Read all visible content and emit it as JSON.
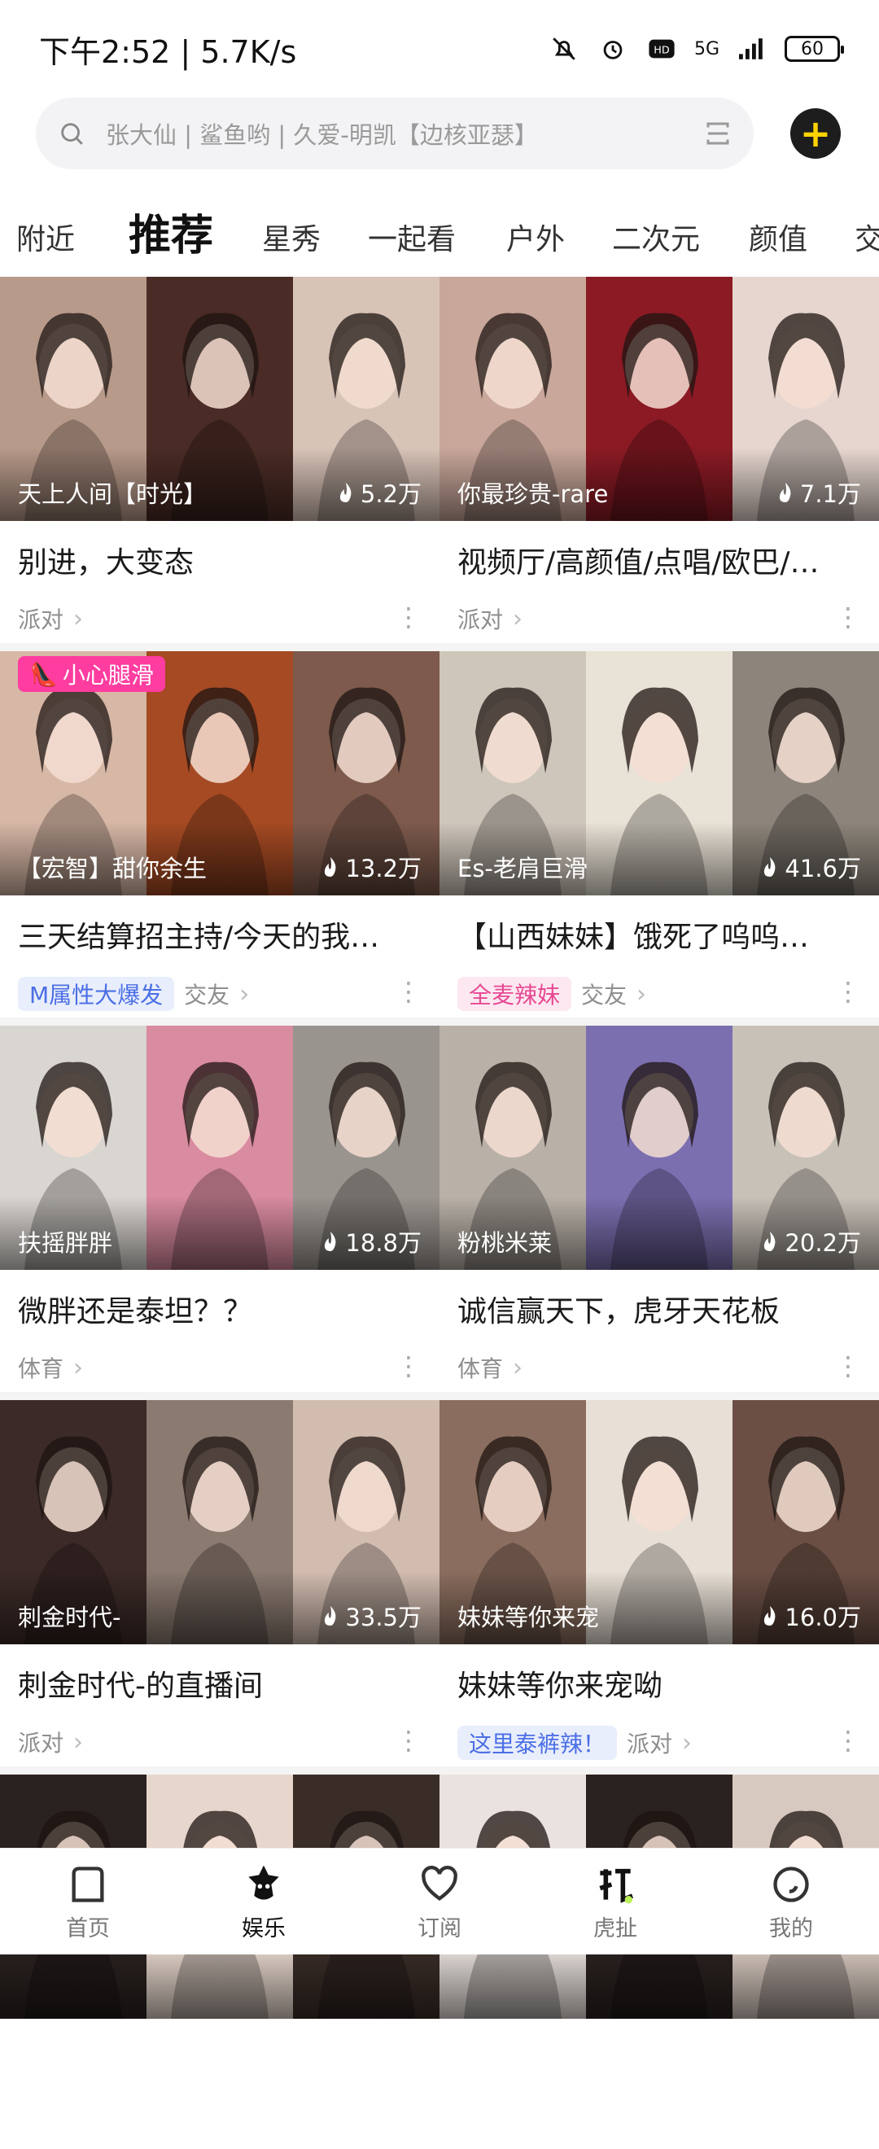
{
  "status": {
    "time": "下午2:52 | 5.7K/s",
    "network": "5G",
    "battery": "60"
  },
  "search": {
    "placeholder": "张大仙 | 鲨鱼哟 | 久爱-明凯【边核亚瑟】"
  },
  "tabs": [
    "附近",
    "推荐",
    "星秀",
    "一起看",
    "户外",
    "二次元",
    "颜值",
    "交"
  ],
  "active_tab": "推荐",
  "cards": [
    {
      "streamer": "天上人间【时光】",
      "heat": "5.2万",
      "title": "别进，大变态",
      "tags": [],
      "category": "派对",
      "badge": "",
      "thumb_colors": [
        "#b89a8a",
        "#4a2b25",
        "#d8c3b7"
      ]
    },
    {
      "streamer": "你最珍贵-rare",
      "heat": "7.1万",
      "title": "视频厅/高颜值/点唱/欧巴/…",
      "tags": [],
      "category": "派对",
      "badge": "",
      "thumb_colors": [
        "#c9a79b",
        "#8b1a24",
        "#e6d6cf"
      ]
    },
    {
      "streamer": "【宏智】甜你余生",
      "heat": "13.2万",
      "title": "三天结算招主持/今天的我…",
      "tags": [
        {
          "label": "M属性大爆发",
          "style": "blue"
        }
      ],
      "category": "交友",
      "badge": "小心腿滑",
      "thumb_colors": [
        "#d7b7a6",
        "#a54a23",
        "#7d5a4c"
      ]
    },
    {
      "streamer": "Es-老肩巨滑",
      "heat": "41.6万",
      "title": "【山西妹妹】饿死了呜呜…",
      "tags": [
        {
          "label": "全麦辣妹",
          "style": "pink"
        }
      ],
      "category": "交友",
      "badge": "",
      "thumb_colors": [
        "#cfc6bb",
        "#e9e2d6",
        "#8d857b"
      ]
    },
    {
      "streamer": "扶摇胖胖",
      "heat": "18.8万",
      "title": "微胖还是泰坦？？",
      "tags": [],
      "category": "体育",
      "badge": "",
      "thumb_colors": [
        "#d9d5d0",
        "#d98ba0",
        "#9a948f"
      ]
    },
    {
      "streamer": "粉桃米莱",
      "heat": "20.2万",
      "title": "诚信赢天下，虎牙天花板",
      "tags": [],
      "category": "体育",
      "badge": "",
      "thumb_colors": [
        "#b9b1a8",
        "#7c6fb0",
        "#c8c1b8"
      ]
    },
    {
      "streamer": "刺金时代-",
      "heat": "33.5万",
      "title": "刺金时代-的直播间",
      "tags": [],
      "category": "派对",
      "badge": "",
      "thumb_colors": [
        "#3b2a27",
        "#8a7a70",
        "#d2bcb0"
      ]
    },
    {
      "streamer": "妹妹等你来宠",
      "heat": "16.0万",
      "title": "妹妹等你来宠呦",
      "tags": [
        {
          "label": "这里泰裤辣！",
          "style": "blue"
        }
      ],
      "category": "派对",
      "badge": "",
      "thumb_colors": [
        "#8a6d5e",
        "#e8e0d6",
        "#6b4f45"
      ]
    },
    {
      "streamer": "",
      "heat": "",
      "title": "",
      "tags": [],
      "category": "",
      "badge": "",
      "thumb_colors": [
        "#2a2220",
        "#e6d6cc",
        "#3a2d28"
      ]
    },
    {
      "streamer": "",
      "heat": "",
      "title": "",
      "tags": [],
      "category": "",
      "badge": "",
      "thumb_colors": [
        "#e9e2de",
        "#2a2220",
        "#d8c9c0"
      ]
    }
  ],
  "nav": [
    {
      "label": "首页",
      "icon": "home-icon",
      "active": false
    },
    {
      "label": "娱乐",
      "icon": "entertainment-icon",
      "active": true
    },
    {
      "label": "订阅",
      "icon": "heart-icon",
      "active": false
    },
    {
      "label": "虎扯",
      "icon": "huche-icon",
      "active": false
    },
    {
      "label": "我的",
      "icon": "profile-icon",
      "active": false
    }
  ]
}
